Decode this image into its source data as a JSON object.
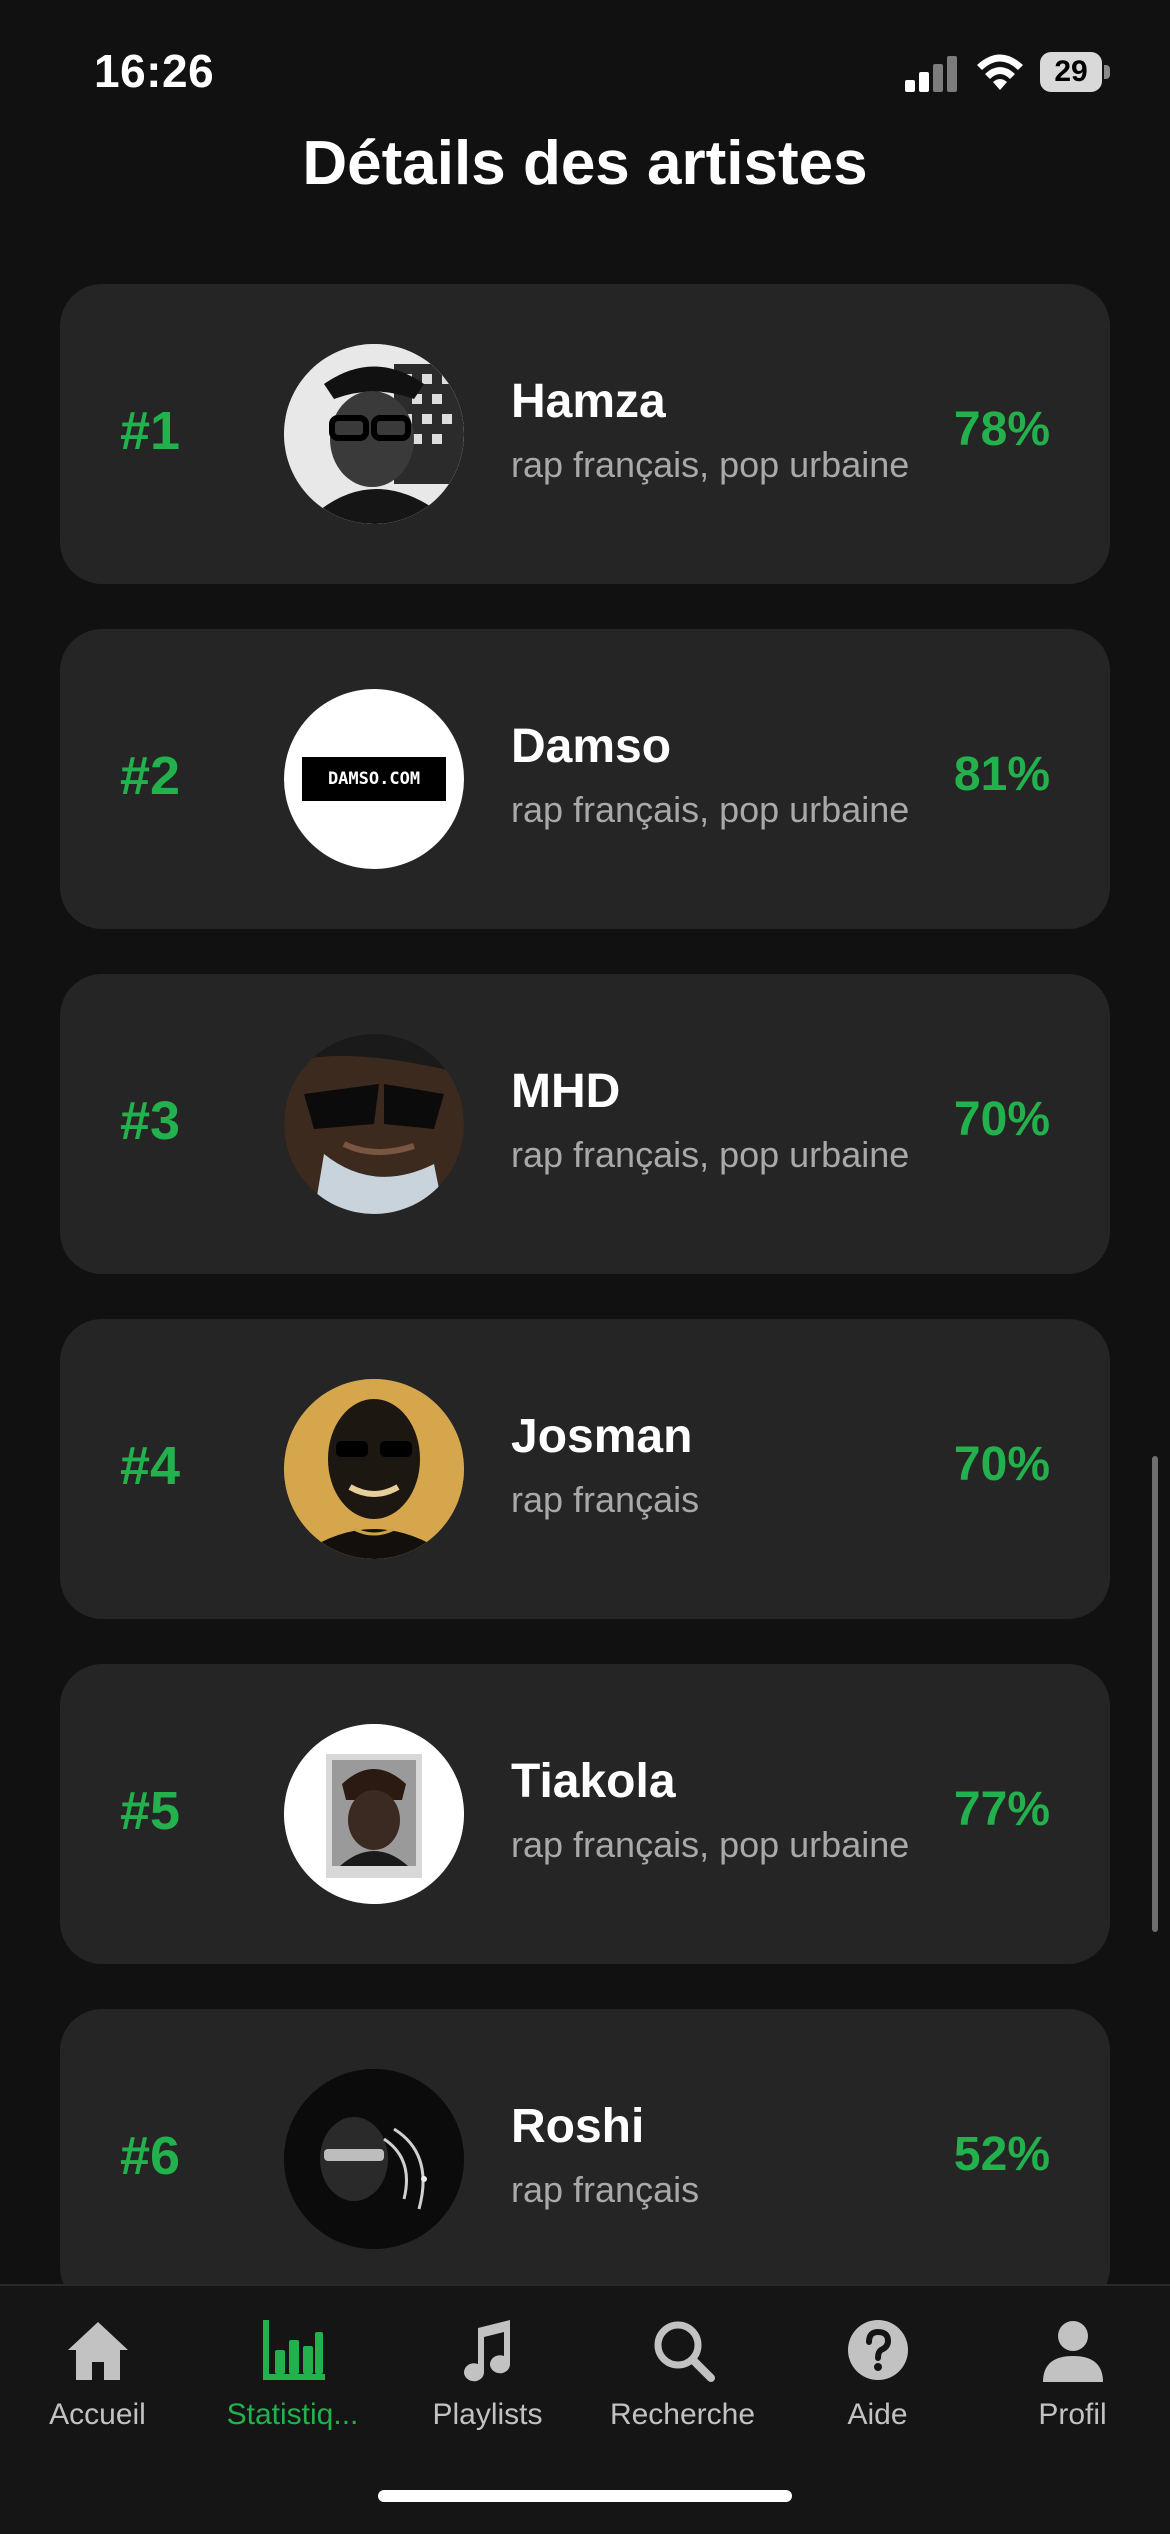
{
  "status_bar": {
    "time": "16:26",
    "battery": "29"
  },
  "page": {
    "title": "Détails des artistes"
  },
  "artists": [
    {
      "rank": "#1",
      "name": "Hamza",
      "genres": "rap français, pop urbaine",
      "percent": "78%"
    },
    {
      "rank": "#2",
      "name": "Damso",
      "genres": "rap français, pop urbaine",
      "percent": "81%",
      "logo_text": "DAMSO.COM"
    },
    {
      "rank": "#3",
      "name": "MHD",
      "genres": "rap français, pop urbaine",
      "percent": "70%"
    },
    {
      "rank": "#4",
      "name": "Josman",
      "genres": "rap français",
      "percent": "70%"
    },
    {
      "rank": "#5",
      "name": "Tiakola",
      "genres": "rap français, pop urbaine",
      "percent": "77%"
    },
    {
      "rank": "#6",
      "name": "Roshi",
      "genres": "rap français",
      "percent": "52%"
    }
  ],
  "tabs": [
    {
      "label": "Accueil",
      "icon": "home-icon"
    },
    {
      "label": "Statistiq...",
      "icon": "bar-chart-icon",
      "active": true
    },
    {
      "label": "Playlists",
      "icon": "music-note-icon"
    },
    {
      "label": "Recherche",
      "icon": "search-icon"
    },
    {
      "label": "Aide",
      "icon": "help-icon"
    },
    {
      "label": "Profil",
      "icon": "person-icon"
    }
  ],
  "colors": {
    "accent": "#22b14c",
    "background": "#111111",
    "card": "#252525",
    "muted_text": "#a9a9a9"
  }
}
